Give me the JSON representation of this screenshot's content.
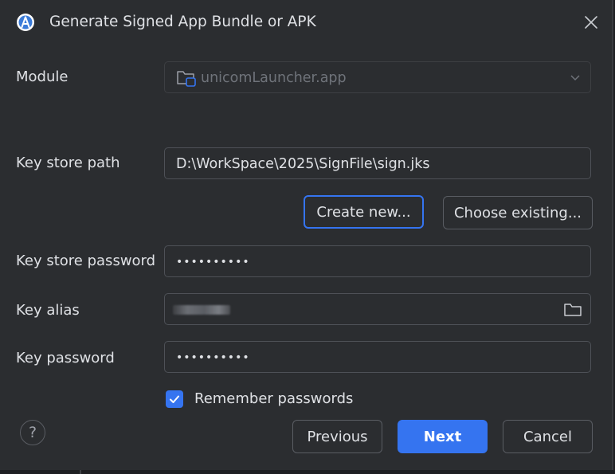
{
  "dialog": {
    "title": "Generate Signed App Bundle or APK"
  },
  "module": {
    "label": "Module",
    "value": "unicomLauncher.app"
  },
  "keystore": {
    "path_label": "Key store path",
    "path_value": "D:\\WorkSpace\\2025\\SignFile\\sign.jks",
    "create_new_label": "Create new...",
    "choose_existing_label": "Choose existing...",
    "password_label": "Key store password",
    "password_value": "••••••••••"
  },
  "key": {
    "alias_label": "Key alias",
    "password_label": "Key password",
    "password_value": "••••••••••"
  },
  "remember": {
    "label": "Remember passwords",
    "checked": true
  },
  "footer": {
    "help_label": "?",
    "previous_label": "Previous",
    "next_label": "Next",
    "cancel_label": "Cancel"
  },
  "colors": {
    "accent": "#3574f0",
    "background": "#2b2d30",
    "text": "#dfe1e5"
  }
}
